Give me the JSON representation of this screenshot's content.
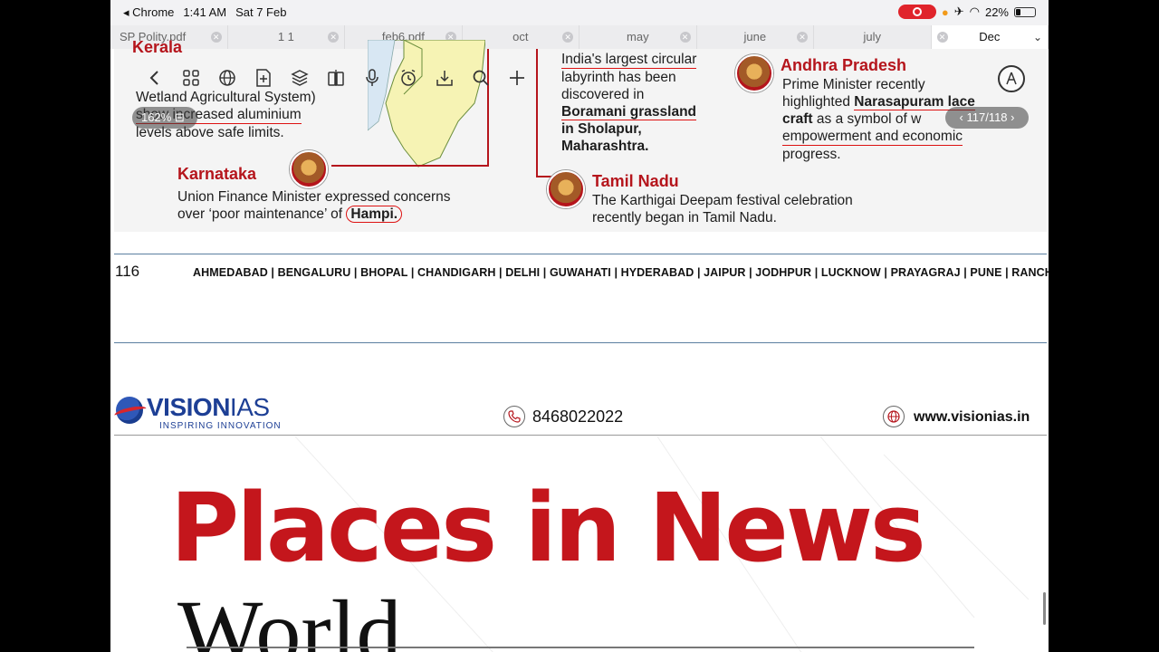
{
  "status": {
    "back_app": "Chrome",
    "time": "1:41 AM",
    "date": "Sat 7 Feb",
    "battery": "22%"
  },
  "tabs": [
    {
      "label": "SP Polity.pdf"
    },
    {
      "label": "1 1"
    },
    {
      "label": "feb6.pdf"
    },
    {
      "label": "oct"
    },
    {
      "label": "may"
    },
    {
      "label": "june"
    },
    {
      "label": "july"
    },
    {
      "label": "Dec"
    }
  ],
  "viewer": {
    "zoom": "162%",
    "page_indicator": "117/118"
  },
  "infographic": {
    "kerala_partial": "Kerala",
    "kerala_text_line1": "Wetland Agricultural System)",
    "kerala_text_line2": "show increased aluminium",
    "kerala_text_line3": "levels above safe limits.",
    "karnataka_title": "Karnataka",
    "karnataka_line1": "Union Finance Minister expressed concerns",
    "karnataka_line2_pre": "over ‘poor maintenance’ of",
    "karnataka_line2_bold": "Hampi.",
    "maharashtra_line1": "India's largest circular",
    "maharashtra_line2": "labyrinth has been",
    "maharashtra_line3": "discovered in",
    "maharashtra_bold1": "Boramani grassland",
    "maharashtra_bold2": "in Sholapur,",
    "maharashtra_bold3": "Maharashtra.",
    "tn_title": "Tamil Nadu",
    "tn_line1": "The Karthigai Deepam festival celebration",
    "tn_line2": "recently began in Tamil Nadu.",
    "ap_title": "Andhra Pradesh",
    "ap_line1": "Prime Minister recently",
    "ap_line2_pre": "highlighted",
    "ap_line2_bold": "Narasapuram lace",
    "ap_line3_bold": "craft",
    "ap_line3_post": "as a symbol of w",
    "ap_line4": "empowerment and economic",
    "ap_line5": "progress."
  },
  "footer": {
    "page_number": "116",
    "cities": "AHMEDABAD | BENGALURU | BHOPAL | CHANDIGARH | DELHI | GUWAHATI | HYDERABAD | JAIPUR | JODHPUR | LUCKNOW | PRAYAGRAJ | PUNE | RANCHI"
  },
  "header": {
    "logo_name": "VISION",
    "logo_name2": "IAS",
    "logo_tagline": "INSPIRING INNOVATION",
    "phone": "8468022022",
    "website": "www.visionias.in"
  },
  "banner": {
    "title": "Places in News",
    "subtitle": "World"
  },
  "colors": {
    "accent_red": "#c4161c",
    "brand_blue": "#1d3f95"
  }
}
